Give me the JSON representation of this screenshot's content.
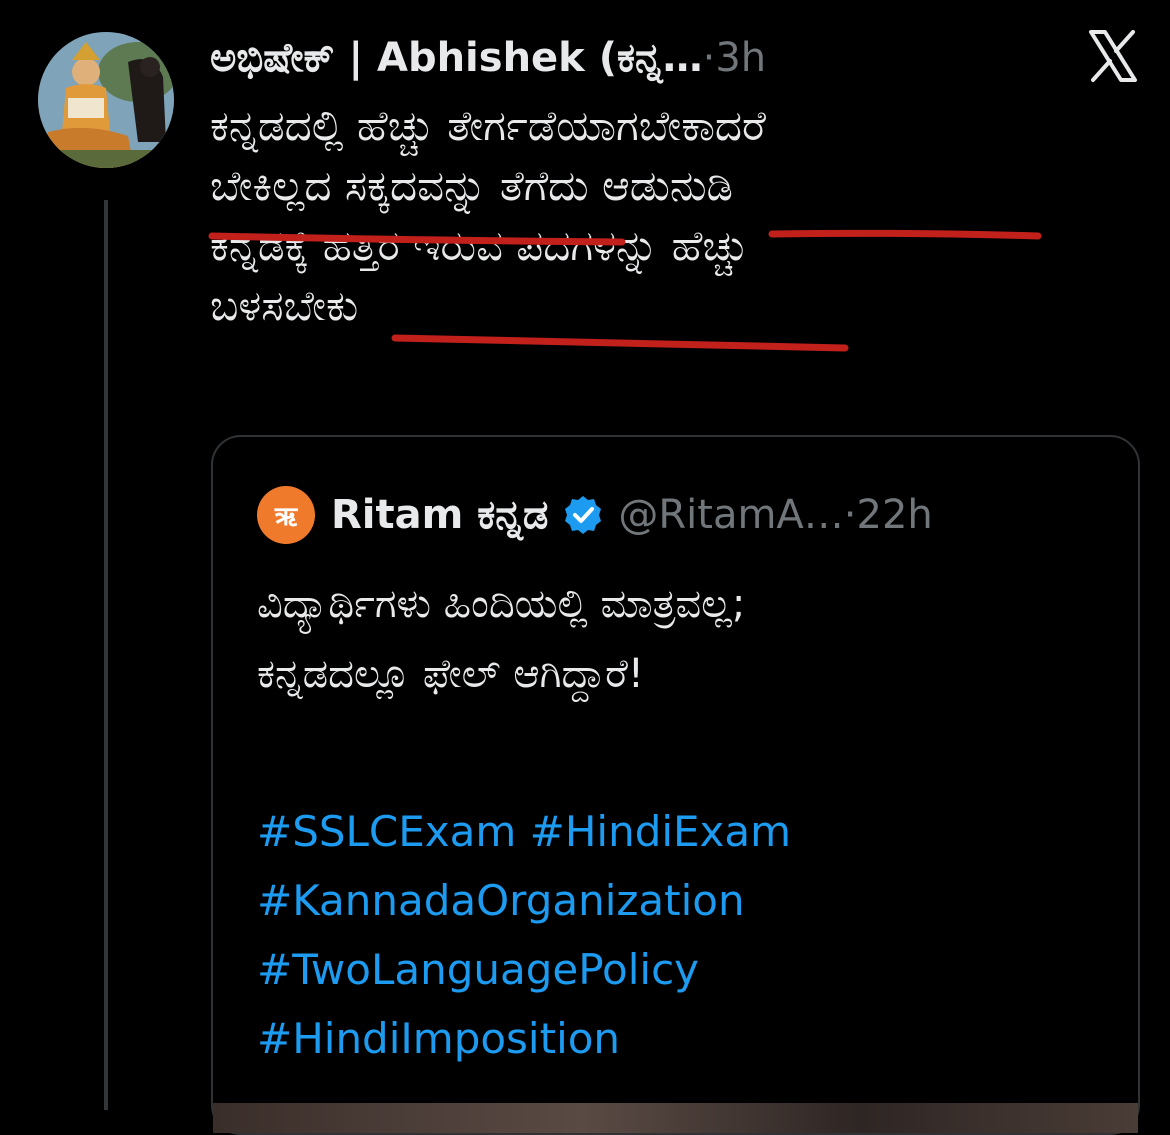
{
  "tweet": {
    "author_name": "ಅಭಿಷೇಕ್ | Abhishek (ಕನ್ನ…",
    "separator": " · ",
    "time": "3h",
    "lines": [
      "ಕನ್ನಡದಲ್ಲಿ ಹೆಚ್ಚು ತೇರ್ಗಡೆಯಾಗಬೇಕಾದರೆ",
      "ಬೇಕಿಲ್ಲದ ಸಕ್ಕದವನ್ನು ತೆಗೆದು ಆಡುನುಡಿ",
      "ಕನ್ನಡಕ್ಕೆ ಹತ್ತಿರ ಇರುವ ಪದಗಳನ್ನು ಹೆಚ್ಚು",
      "ಬಳಸಬೇಕು"
    ],
    "underline_color": "#c1201b"
  },
  "app": {
    "logo_icon": "x-logo-icon"
  },
  "quote": {
    "logo_glyph": "ऋ",
    "logo_color": "#f07a2c",
    "name": "Ritam ಕನ್ನಡ",
    "handle": "@RitamA…",
    "separator": " · ",
    "time": "22h",
    "verified_color": "#1d9bf0",
    "lines": [
      "ವಿದ್ಯಾರ್ಥಿಗಳು ಹಿಂದಿಯಲ್ಲಿ ಮಾತ್ರವಲ್ಲ;",
      "ಕನ್ನಡದಲ್ಲೂ ಫೇಲ್ ಆಗಿದ್ದಾರೆ!"
    ],
    "hashtags": [
      "#SSLCExam  #HindiExam",
      "#KannadaOrganization",
      "#TwoLanguagePolicy",
      "#HindiImposition"
    ],
    "hashtag_color": "#1d9bf0"
  }
}
